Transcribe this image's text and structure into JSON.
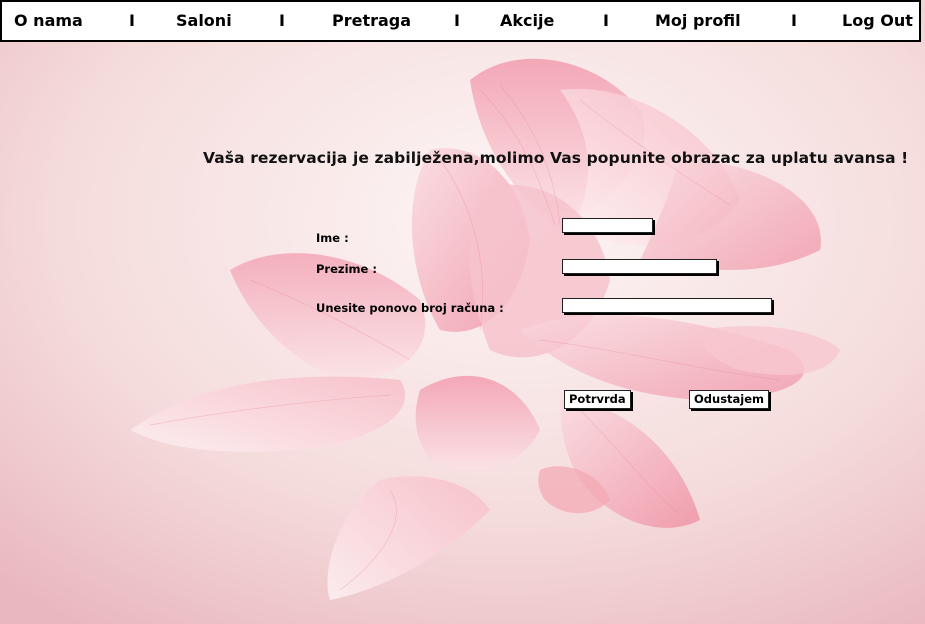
{
  "nav": {
    "items": [
      "O nama",
      "Saloni",
      "Pretraga",
      "Akcije",
      "Moj profil",
      "Log Out"
    ],
    "separator": "I"
  },
  "form": {
    "heading": "Vaša rezervacija je zabilježena,molimo Vas popunite obrazac za uplatu avansa !",
    "fields": [
      {
        "label": "Ime :",
        "value": ""
      },
      {
        "label": "Prezime :",
        "value": ""
      },
      {
        "label": "Unesite ponovo broj računa :",
        "value": ""
      }
    ],
    "confirm_label": "Potrvrda",
    "cancel_label": "Odustajem"
  }
}
